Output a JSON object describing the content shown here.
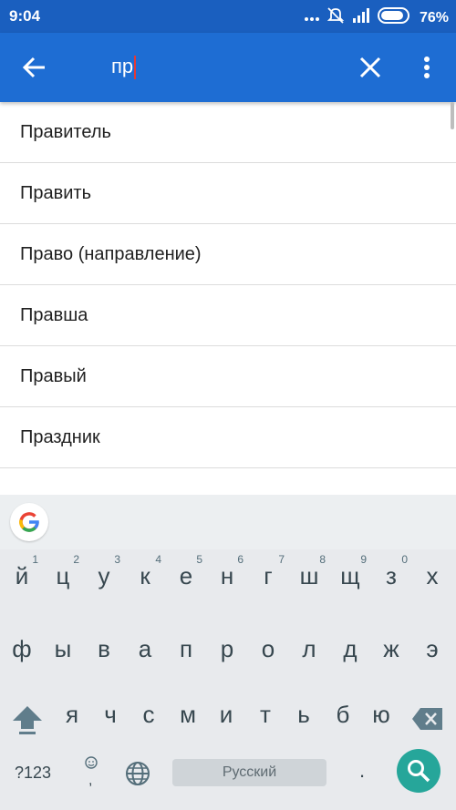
{
  "status_bar": {
    "time": "9:04",
    "battery": "76%"
  },
  "search": {
    "query": "пр"
  },
  "results": [
    "Правитель",
    "Править",
    "Право (направление)",
    "Правша",
    "Правый",
    "Праздник"
  ],
  "keyboard": {
    "row1": [
      "й",
      "ц",
      "у",
      "к",
      "е",
      "н",
      "г",
      "ш",
      "щ",
      "з",
      "х"
    ],
    "row1_hints": [
      "1",
      "2",
      "3",
      "4",
      "5",
      "6",
      "7",
      "8",
      "9",
      "0",
      ""
    ],
    "row2": [
      "ф",
      "ы",
      "в",
      "а",
      "п",
      "р",
      "о",
      "л",
      "д",
      "ж",
      "э"
    ],
    "row3": [
      "я",
      "ч",
      "с",
      "м",
      "и",
      "т",
      "ь",
      "б",
      "ю"
    ],
    "symbols_label": "?123",
    "space_label": "Русский",
    "period": "."
  },
  "colors": {
    "status_bar": "#1a5fbf",
    "app_bar": "#1e6dd3",
    "search_key": "#26a69a"
  }
}
